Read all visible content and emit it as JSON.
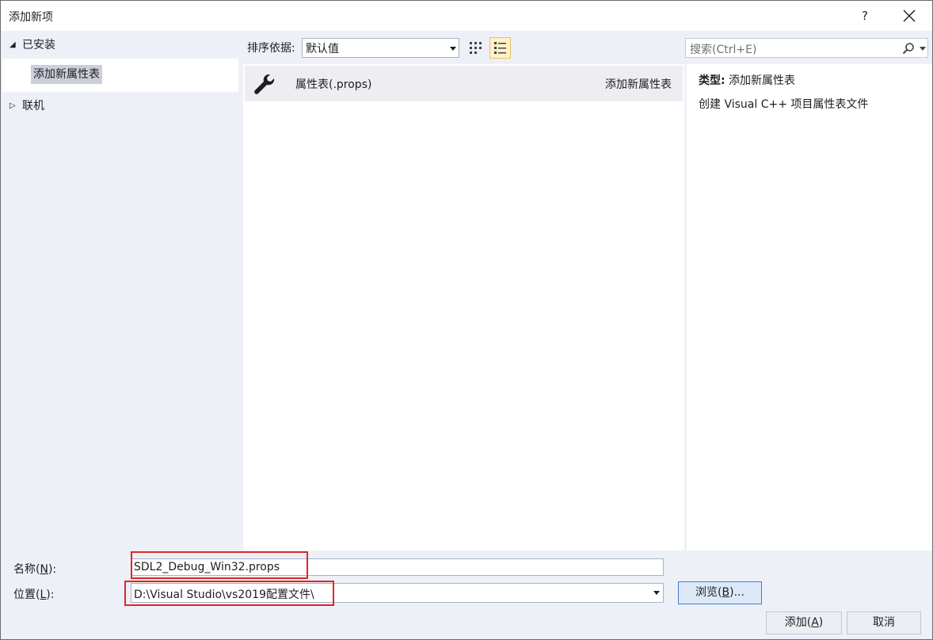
{
  "dialog": {
    "title": "添加新项",
    "help_label": "?"
  },
  "tree": {
    "installed": "已安装",
    "selected_item": "添加新属性表",
    "online": "联机"
  },
  "toolbar": {
    "sort_label": "排序依据:",
    "sort_value": "默认值",
    "search_placeholder": "搜索(Ctrl+E)"
  },
  "list": {
    "items": [
      {
        "name": "属性表(.props)",
        "type": "添加新属性表",
        "icon": "wrench-icon"
      }
    ]
  },
  "details": {
    "type_label": "类型:",
    "type_value": "添加新属性表",
    "description": "创建 Visual C++ 项目属性表文件"
  },
  "form": {
    "name_label_prefix": "名称(",
    "name_label_key": "N",
    "name_label_suffix": "):",
    "name_value": "SDL2_Debug_Win32.props",
    "location_label_prefix": "位置(",
    "location_label_key": "L",
    "location_label_suffix": "):",
    "location_value": "D:\\Visual Studio\\vs2019配置文件\\"
  },
  "buttons": {
    "browse_prefix": "浏览(",
    "browse_key": "B",
    "browse_suffix": ")...",
    "add_prefix": "添加(",
    "add_key": "A",
    "add_suffix": ")",
    "cancel": "取消"
  },
  "colors": {
    "highlight_box": "#e02626",
    "selection": "#cccedb",
    "background": "#eef0f8"
  }
}
